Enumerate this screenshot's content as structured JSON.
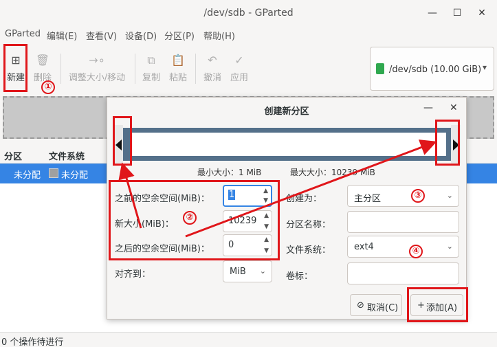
{
  "window": {
    "title": "/dev/sdb - GParted"
  },
  "menu": [
    "GParted",
    "编辑(E)",
    "查看(V)",
    "设备(D)",
    "分区(P)",
    "帮助(H)"
  ],
  "toolbar": {
    "new": "新建",
    "delete": "删除",
    "resize": "调整大小/移动",
    "copy": "复制",
    "paste": "粘贴",
    "undo": "撤消",
    "apply": "应用"
  },
  "device": {
    "label": "/dev/sdb",
    "size": "(10.00 GiB)"
  },
  "table": {
    "headers": [
      "分区",
      "文件系统"
    ],
    "rows": [
      {
        "partition": "未分配",
        "filesystem": "未分配"
      }
    ]
  },
  "status": "0 个操作待进行",
  "dialog": {
    "title": "创建新分区",
    "min_size": "最小大小：1 MiB",
    "max_size": "最大大小：10239 MiB",
    "free_before_label": "之前的空余空间(MiB)：",
    "free_before_value": "1",
    "new_size_label": "新大小(MiB)：",
    "new_size_value": "10239",
    "free_after_label": "之后的空余空间(MiB)：",
    "free_after_value": "0",
    "align_label": "对齐到：",
    "align_value": "MiB",
    "create_as_label": "创建为：",
    "create_as_value": "主分区",
    "name_label": "分区名称：",
    "name_value": "",
    "fs_label": "文件系统：",
    "fs_value": "ext4",
    "vol_label": "卷标：",
    "vol_value": "",
    "cancel": "取消(C)",
    "add": "添加(A)"
  },
  "annotations": [
    "①",
    "②",
    "③",
    "④"
  ],
  "colors": {
    "selection": "#3584e4",
    "annotation": "#e0161a",
    "partition_bar": "#54708a"
  }
}
